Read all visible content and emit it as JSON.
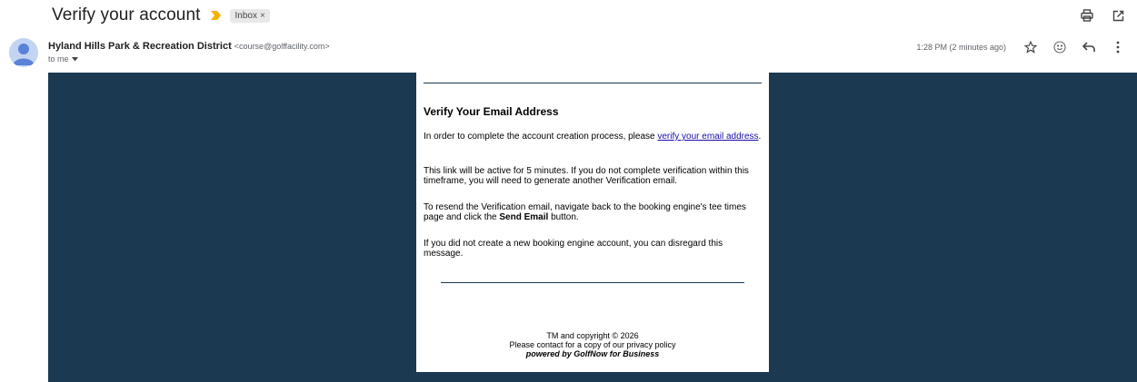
{
  "header": {
    "subject": "Verify your account",
    "label_chip": "Inbox",
    "label_chip_close": "×"
  },
  "sender": {
    "name": "Hyland Hills Park & Recreation District",
    "email": "<course@golffacility.com>",
    "to": "to me",
    "timestamp": "1:28 PM (2 minutes ago)"
  },
  "icons": {
    "print": "print-icon",
    "open_new": "open-in-new-window-icon",
    "star": "star-icon",
    "emoji": "emoji-reaction-icon",
    "reply": "reply-icon",
    "more": "more-vert-icon"
  },
  "email": {
    "heading": "Verify Your Email Address",
    "p1_text": "In order to complete the account creation process, please ",
    "p1_link": "verify your email address",
    "p1_end": ".",
    "p2": "This link will be active for 5 minutes. If you do not complete verification within this timeframe, you will need to generate another Verification email.",
    "p3_start": "To resend the Verification email, navigate back to the booking engine's tee times page and click the ",
    "p3_bold": "Send Email",
    "p3_end": " button.",
    "p4": "If you did not create a new booking engine account, you can disregard this message.",
    "footer_copyright": "TM and copyright © 2026",
    "footer_privacy": "Please contact  for a copy of our privacy policy",
    "footer_powered": "powered by GolfNow for Business"
  },
  "colors": {
    "email_background": "#1b3a52",
    "link": "#1a0dab",
    "importance_marker": "#f4b400",
    "avatar_bg": "#c2d4f1"
  }
}
